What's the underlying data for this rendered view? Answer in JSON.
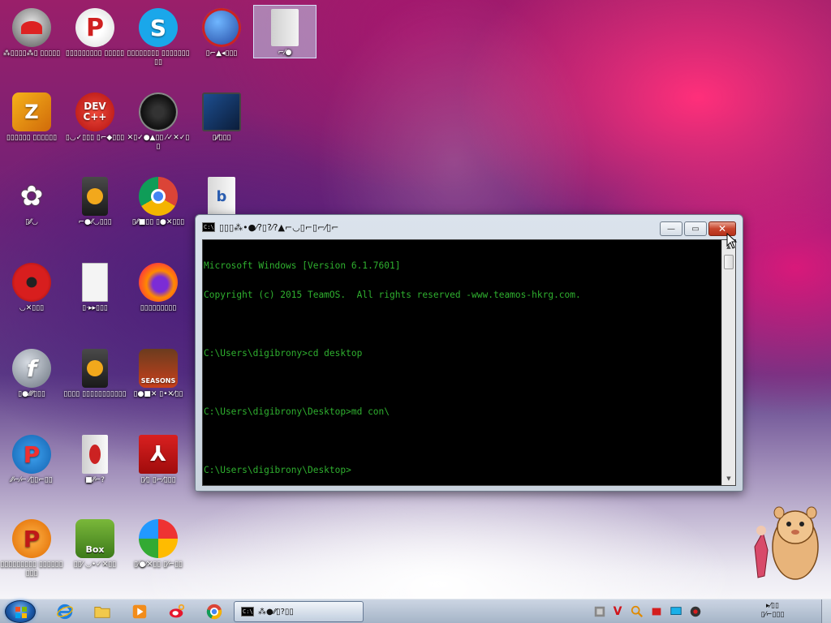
{
  "desktop": {
    "icons": [
      {
        "id": "icon-r1c1",
        "label": "⁂▯▯▯▯⁂▯ ▯▯▯▯▯"
      },
      {
        "id": "icon-r1c2",
        "label": "▯▯▯▯▯▯▯▯▯ ▯▯▯▯▯"
      },
      {
        "id": "icon-skype",
        "label": "▯▯▯▯▯▯▯▯ ▯▯▯▯▯▯▯▯▯"
      },
      {
        "id": "icon-r1c4",
        "label": "▯⌐▲◂▯▯▯"
      },
      {
        "id": "icon-r1c5",
        "label": "⌐⁄●"
      },
      {
        "id": "icon-r2c1",
        "label": "▯▯▯▯▯▯ ▯▯▯▯▯▯"
      },
      {
        "id": "icon-devcpp",
        "label": "▯◡✓▯▯▯ ▯⌐◆▯▯▯"
      },
      {
        "id": "icon-r2c3",
        "label": "✕▯✓●▲▯▯ ⁄✓✕✓▯▯"
      },
      {
        "id": "icon-r2c4",
        "label": "▯⁄⁄▯▯▯"
      },
      {
        "id": "icon-r3c1",
        "label": "▯⁄⁄◡"
      },
      {
        "id": "icon-r3c2",
        "label": "⌐●⁄⁄◡▯▯▯"
      },
      {
        "id": "icon-chrome",
        "label": "▯⁄⁄■▯▯ ▯●✕▯▯▯"
      },
      {
        "id": "icon-r4c1",
        "label": "◡✕▯▯▯"
      },
      {
        "id": "icon-r4c2",
        "label": "▯·▸▸▯▯▯"
      },
      {
        "id": "icon-firefox",
        "label": "▯▯▯▯▯▯▯▯▯"
      },
      {
        "id": "icon-flash",
        "label": "▯●⁄⁄⁄⁄▯▯▯"
      },
      {
        "id": "icon-r5c2",
        "label": "▯▯▯▯ ▯▯▯▯▯▯▯▯▯▯▯"
      },
      {
        "id": "icon-angry-seasons",
        "label": "▯●■✕ ▯•✕⁄▯▯"
      },
      {
        "id": "icon-r6c1",
        "label": "⁄⁄⌐⁄⌐ ⁄▯▯⌐▯▯"
      },
      {
        "id": "icon-r6c2",
        "label": "■⁄⁄⌐?"
      },
      {
        "id": "icon-acrobat",
        "label": "▯⁄▯ ▯⌐⁄▯▯▯"
      },
      {
        "id": "icon-r7c1",
        "label": "▯▯▯▯▯▯▯▯▯ ▯▯▯▯▯▯▯▯▯"
      },
      {
        "id": "icon-box",
        "label": "▯▯⁄ ◡•✓✕▯▯"
      },
      {
        "id": "icon-r7c3",
        "label": "▯⁄●⁄✕▯▯ ▯⁄⌐▯▯"
      }
    ]
  },
  "cmd": {
    "title": "▯▯▯⁂•●⁄?▯?⁄?▲⌐◡▯⌐▯⌐⁄▯⌐",
    "icon_text": "C:\\",
    "lines": [
      "Microsoft Windows [Version 6.1.7601]",
      "Copyright (c) 2015 TeamOS.  All rights reserved -www.teamos-hkrg.com.",
      "",
      "C:\\Users\\digibrony>cd desktop",
      "",
      "C:\\Users\\digibrony\\Desktop>md con\\",
      "",
      "C:\\Users\\digibrony\\Desktop>"
    ],
    "buttons": {
      "minimize": "—",
      "maximize": "▭",
      "close": "✕"
    }
  },
  "taskbar": {
    "task_label": "⁂●⁄⁄▯?▯▯",
    "task_icon_text": "C:\\",
    "tray_text_line1": "▸⁄▯▯",
    "tray_text_line2": "▯⁄⌐▯▯▯"
  }
}
